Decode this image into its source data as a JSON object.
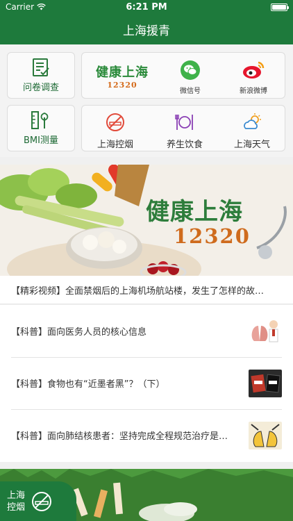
{
  "status_bar": {
    "carrier": "Carrier",
    "time": "6:21 PM"
  },
  "nav": {
    "title": "上海援青"
  },
  "tiles": {
    "survey": "问卷调查",
    "logo": {
      "text": "健康上海",
      "number": "12320"
    },
    "wechat": "微信号",
    "weibo": "新浪微博",
    "bmi": "BMI测量",
    "smoking": "上海控烟",
    "diet": "养生饮食",
    "weather": "上海天气"
  },
  "banner": {
    "headline": "健康上海",
    "number": "12320"
  },
  "caption": "【精彩视频】全面禁烟后的上海机场航站楼，发生了怎样的故…",
  "news": [
    {
      "text": "【科普】面向医务人员的核心信息"
    },
    {
      "text": "【科普】食物也有“近墨者黑”？（下）"
    },
    {
      "text": "【科普】面向肺结核患者：坚持完成全程规范治疗是…"
    }
  ],
  "fab": {
    "label": "上海控烟"
  },
  "colors": {
    "brand": "#1e7a3c",
    "accent": "#d46a1a"
  }
}
